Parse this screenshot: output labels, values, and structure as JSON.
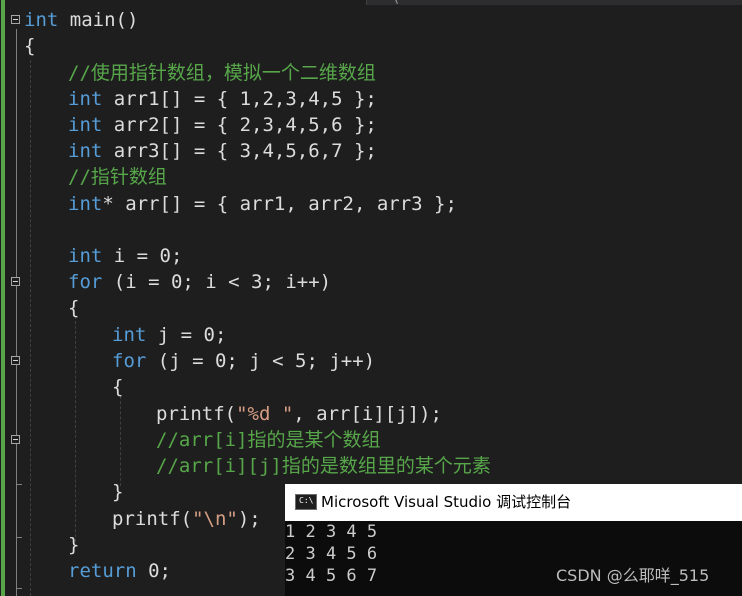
{
  "editor": {
    "top_tab_fragment": "(",
    "lines": [
      {
        "tokens": [
          {
            "t": "int",
            "c": "kw"
          },
          {
            "t": " main()",
            "c": "tx"
          }
        ]
      },
      {
        "tokens": [
          {
            "t": "{",
            "c": "tx"
          }
        ]
      },
      {
        "tokens": [
          {
            "t": "//使用指针数组，模拟一个二维数组",
            "c": "cm"
          }
        ]
      },
      {
        "tokens": [
          {
            "t": "int",
            "c": "kw"
          },
          {
            "t": " arr1[] = { 1,2,3,4,5 };",
            "c": "tx"
          }
        ]
      },
      {
        "tokens": [
          {
            "t": "int",
            "c": "kw"
          },
          {
            "t": " arr2[] = { 2,3,4,5,6 };",
            "c": "tx"
          }
        ]
      },
      {
        "tokens": [
          {
            "t": "int",
            "c": "kw"
          },
          {
            "t": " arr3[] = { 3,4,5,6,7 };",
            "c": "tx"
          }
        ]
      },
      {
        "tokens": [
          {
            "t": "//指针数组",
            "c": "cm"
          }
        ]
      },
      {
        "tokens": [
          {
            "t": "int",
            "c": "kw"
          },
          {
            "t": "* arr[] = { arr1, arr2, arr3 };",
            "c": "tx"
          }
        ]
      },
      {
        "tokens": []
      },
      {
        "tokens": [
          {
            "t": "int",
            "c": "kw"
          },
          {
            "t": " i = 0;",
            "c": "tx"
          }
        ]
      },
      {
        "tokens": [
          {
            "t": "for",
            "c": "kw"
          },
          {
            "t": " (i = 0; i < 3; i++)",
            "c": "tx"
          }
        ]
      },
      {
        "tokens": [
          {
            "t": "{",
            "c": "tx"
          }
        ]
      },
      {
        "tokens": [
          {
            "t": "int",
            "c": "kw"
          },
          {
            "t": " j = 0;",
            "c": "tx"
          }
        ]
      },
      {
        "tokens": [
          {
            "t": "for",
            "c": "kw"
          },
          {
            "t": " (j = 0; j < 5; j++)",
            "c": "tx"
          }
        ]
      },
      {
        "tokens": [
          {
            "t": "{",
            "c": "tx"
          }
        ]
      },
      {
        "tokens": [
          {
            "t": "printf(",
            "c": "tx"
          },
          {
            "t": "\"%d \"",
            "c": "st"
          },
          {
            "t": ", arr[i][j]);",
            "c": "tx"
          }
        ]
      },
      {
        "tokens": [
          {
            "t": "//arr[i]指的是某个数组",
            "c": "cm"
          }
        ]
      },
      {
        "tokens": [
          {
            "t": "//arr[i][j]指的是数组里的某个元素",
            "c": "cm"
          }
        ]
      },
      {
        "tokens": [
          {
            "t": "}",
            "c": "tx"
          }
        ]
      },
      {
        "tokens": [
          {
            "t": "printf(",
            "c": "tx"
          },
          {
            "t": "\"\\n\"",
            "c": "st"
          },
          {
            "t": ");",
            "c": "tx"
          }
        ]
      },
      {
        "tokens": [
          {
            "t": "}",
            "c": "tx"
          }
        ]
      },
      {
        "tokens": [
          {
            "t": "return",
            "c": "kw"
          },
          {
            "t": " 0;",
            "c": "tx"
          }
        ]
      }
    ]
  },
  "console": {
    "icon_text": "C:\\",
    "title": "Microsoft Visual Studio 调试控制台",
    "output_lines": [
      "1 2 3 4 5",
      "2 3 4 5 6",
      "3 4 5 6 7"
    ]
  },
  "watermark": "CSDN @么耶咩_515",
  "colors": {
    "background": "#1e1e1e",
    "keyword": "#569cd6",
    "comment": "#57a64a",
    "text": "#dcdcdc",
    "string": "#d69d85",
    "change_bar": "#57a64a",
    "console_bg": "#0c0c0c",
    "console_title_bg": "#ffffff"
  }
}
